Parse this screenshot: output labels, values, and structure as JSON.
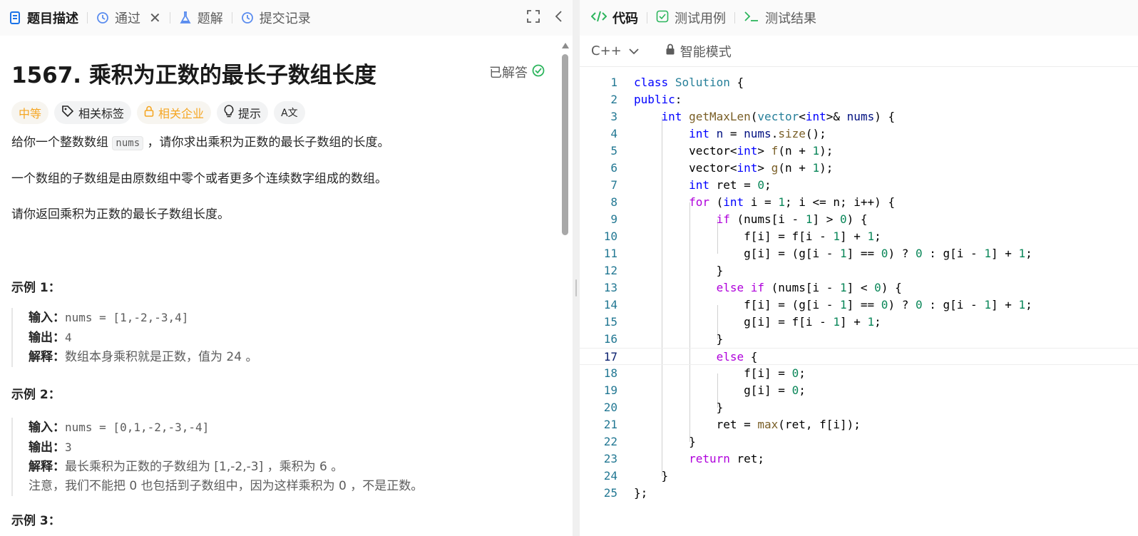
{
  "left_tabs": {
    "description": "题目描述",
    "accepted": "通过",
    "solutions": "题解",
    "submissions": "提交记录"
  },
  "problem": {
    "title": "1567. 乘积为正数的最长子数组长度",
    "status": "已解答",
    "tags": {
      "difficulty": "中等",
      "related_tags": "相关标签",
      "related_companies": "相关企业",
      "hints": "提示",
      "translate": "A文"
    },
    "desc1_pre": "给你一个整数数组 ",
    "desc1_code": "nums",
    "desc1_post": " ，请你求出乘积为正数的最长子数组的长度。",
    "desc2": "一个数组的子数组是由原数组中零个或者更多个连续数字组成的数组。",
    "desc3": "请你返回乘积为正数的最长子数组长度。"
  },
  "examples": [
    {
      "title": "示例  1：",
      "input_label": "输入：",
      "input": "nums = [1,-2,-3,4]",
      "output_label": "输出：",
      "output": "4",
      "explain_label": "解释：",
      "explain": "数组本身乘积就是正数，值为 24 。"
    },
    {
      "title": "示例 2：",
      "input_label": "输入：",
      "input": "nums = [0,1,-2,-3,-4]",
      "output_label": "输出：",
      "output": "3",
      "explain_label": "解释：",
      "explain": "最长乘积为正数的子数组为 [1,-2,-3] ，乘积为 6 。",
      "note": "注意，我们不能把 0 也包括到子数组中，因为这样乘积为 0 ，不是正数。"
    }
  ],
  "example3_partial": "示例 3：",
  "right_tabs": {
    "code": "代码",
    "testcases": "测试用例",
    "results": "测试结果"
  },
  "toolbar": {
    "language": "C++",
    "mode": "智能模式"
  },
  "editor": {
    "active_line": 17,
    "line_numbers": [
      "1",
      "2",
      "3",
      "4",
      "5",
      "6",
      "7",
      "8",
      "9",
      "10",
      "11",
      "12",
      "13",
      "14",
      "15",
      "16",
      "17",
      "18",
      "19",
      "20",
      "21",
      "22",
      "23",
      "24",
      "25"
    ]
  }
}
